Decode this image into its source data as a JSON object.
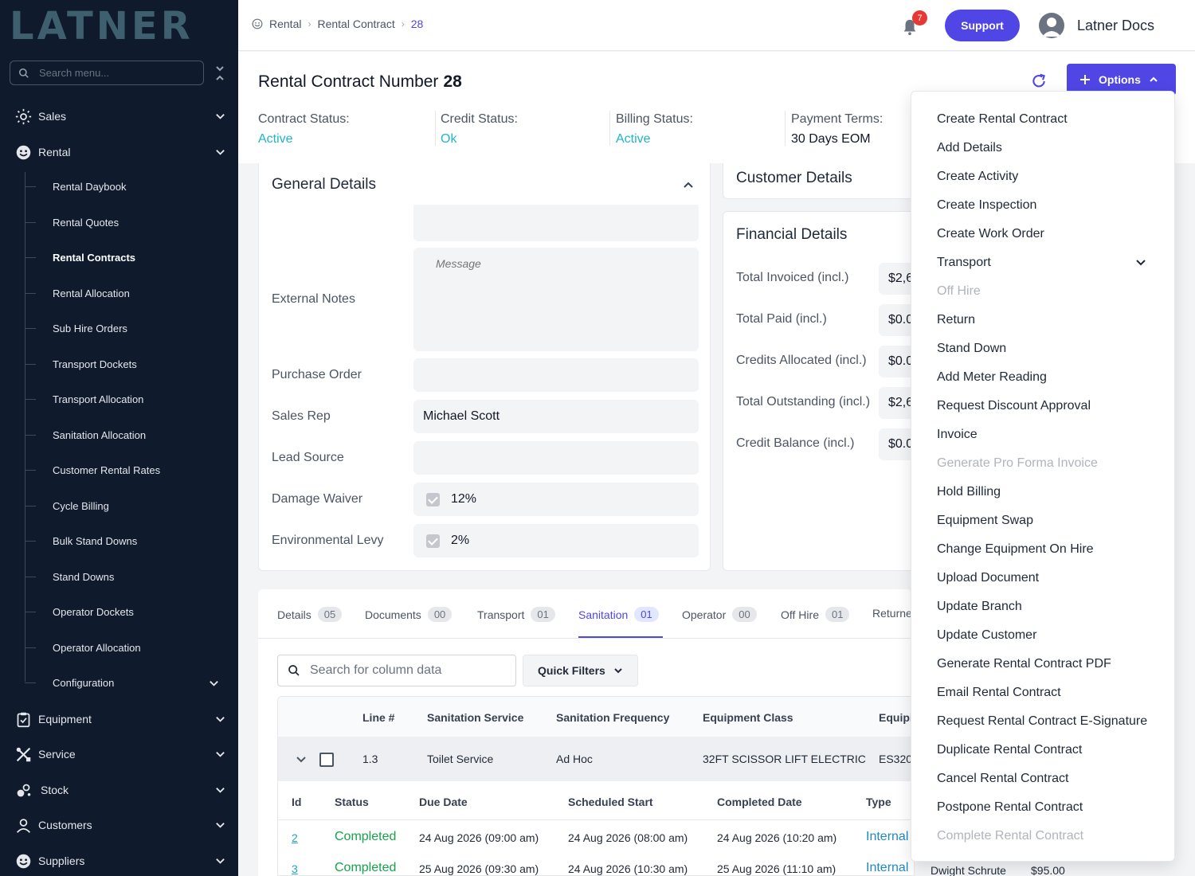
{
  "sidebar": {
    "logo": "LATNER",
    "search_placeholder": "Search menu...",
    "sections": [
      {
        "label": "Sales",
        "icon": "sun-gear-icon"
      },
      {
        "label": "Rental",
        "icon": "smile-face-icon"
      },
      {
        "label": "Equipment",
        "icon": "clipboard-icon"
      },
      {
        "label": "Service",
        "icon": "tools-icon"
      },
      {
        "label": "Stock",
        "icon": "stock-icon"
      },
      {
        "label": "Customers",
        "icon": "user-icon"
      },
      {
        "label": "Suppliers",
        "icon": "supplier-face-icon"
      }
    ],
    "rental_items": [
      "Rental Daybook",
      "Rental Quotes",
      "Rental Contracts",
      "Rental Allocation",
      "Sub Hire Orders",
      "Transport Dockets",
      "Transport Allocation",
      "Sanitation Allocation",
      "Customer Rental Rates",
      "Cycle Billing",
      "Bulk Stand Downs",
      "Stand Downs",
      "Operator Dockets",
      "Operator Allocation",
      "Configuration"
    ],
    "active_item": "Rental Contracts"
  },
  "topbar": {
    "breadcrumb": [
      "Rental",
      "Rental Contract",
      "28"
    ],
    "notification_count": "7",
    "support_label": "Support",
    "user_name": "Latner Docs"
  },
  "header": {
    "title_prefix": "Rental Contract Number",
    "contract_number": "28",
    "options_label": "Options",
    "stats": [
      {
        "label": "Contract Status:",
        "value": "Active"
      },
      {
        "label": "Credit Status:",
        "value": "Ok"
      },
      {
        "label": "Billing Status:",
        "value": "Active"
      },
      {
        "label": "Payment Terms:",
        "value": "30 Days EOM"
      }
    ]
  },
  "general": {
    "title": "General Details",
    "external_notes_label": "External Notes",
    "message_placeholder": "Message",
    "purchase_order_label": "Purchase Order",
    "sales_rep_label": "Sales Rep",
    "sales_rep_value": "Michael Scott",
    "lead_source_label": "Lead Source",
    "damage_waiver_label": "Damage Waiver",
    "damage_waiver_value": "12%",
    "env_levy_label": "Environmental Levy",
    "env_levy_value": "2%"
  },
  "customer": {
    "title": "Customer Details"
  },
  "financial": {
    "title": "Financial Details",
    "rows": [
      {
        "label": "Total Invoiced (incl.)",
        "value": "$2,6"
      },
      {
        "label": "Total Paid (incl.)",
        "value": "$0.0"
      },
      {
        "label": "Credits Allocated (incl.)",
        "value": "$0.0"
      },
      {
        "label": "Total Outstanding (incl.)",
        "value": "$2,6"
      },
      {
        "label": "Credit Balance (incl.)",
        "value": "$0.0"
      }
    ]
  },
  "tabs": [
    {
      "label": "Details",
      "count": "05"
    },
    {
      "label": "Documents",
      "count": "00"
    },
    {
      "label": "Transport",
      "count": "01"
    },
    {
      "label": "Sanitation",
      "count": "01"
    },
    {
      "label": "Operator",
      "count": "00"
    },
    {
      "label": "Off Hire",
      "count": "01"
    },
    {
      "label": "Returne",
      "count": ""
    }
  ],
  "table": {
    "search_placeholder": "Search for column data",
    "quick_filters": "Quick Filters",
    "headers": [
      "Line #",
      "Sanitation Service",
      "Sanitation Frequency",
      "Equipment Class",
      "Equipi"
    ],
    "row": {
      "line": "1.3",
      "service": "Toilet Service",
      "frequency": "Ad Hoc",
      "class": "32FT SCISSOR LIFT ELECTRIC",
      "equip": "ES320"
    },
    "sub_headers": [
      "Id",
      "Status",
      "Due Date",
      "Scheduled Start",
      "Completed Date",
      "Type"
    ],
    "sub_rows": [
      {
        "id": "2",
        "status": "Completed",
        "due": "24 Aug 2026 (09:00 am)",
        "start": "24 Aug 2026 (08:00 am)",
        "completed": "24 Aug 2026 (10:20 am)",
        "type": "Internal",
        "person": "",
        "price": ""
      },
      {
        "id": "3",
        "status": "Completed",
        "due": "25 Aug 2026 (09:30 am)",
        "start": "24 Aug 2026 (10:30 am)",
        "completed": "25 Aug 2026 (11:10 am)",
        "type": "Internal",
        "person": "Dwight Schrute",
        "price": "$95.00"
      }
    ]
  },
  "options_menu": [
    {
      "label": "Create Rental Contract",
      "disabled": false
    },
    {
      "label": "Add Details",
      "disabled": false
    },
    {
      "label": "Create Activity",
      "disabled": false
    },
    {
      "label": "Create Inspection",
      "disabled": false
    },
    {
      "label": "Create Work Order",
      "disabled": false
    },
    {
      "label": "Transport",
      "disabled": false,
      "submenu": true
    },
    {
      "label": "Off Hire",
      "disabled": true
    },
    {
      "label": "Return",
      "disabled": false
    },
    {
      "label": "Stand Down",
      "disabled": false
    },
    {
      "label": "Add Meter Reading",
      "disabled": false
    },
    {
      "label": "Request Discount Approval",
      "disabled": false
    },
    {
      "label": "Invoice",
      "disabled": false
    },
    {
      "label": "Generate Pro Forma Invoice",
      "disabled": true
    },
    {
      "label": "Hold Billing",
      "disabled": false
    },
    {
      "label": "Equipment Swap",
      "disabled": false
    },
    {
      "label": "Change Equipment On Hire",
      "disabled": false
    },
    {
      "label": "Upload Document",
      "disabled": false
    },
    {
      "label": "Update Branch",
      "disabled": false
    },
    {
      "label": "Update Customer",
      "disabled": false
    },
    {
      "label": "Generate Rental Contract PDF",
      "disabled": false
    },
    {
      "label": "Email Rental Contract",
      "disabled": false
    },
    {
      "label": "Request Rental Contract E-Signature",
      "disabled": false
    },
    {
      "label": "Duplicate Rental Contract",
      "disabled": false
    },
    {
      "label": "Cancel Rental Contract",
      "disabled": false
    },
    {
      "label": "Postpone Rental Contract",
      "disabled": false
    },
    {
      "label": "Complete Rental Contract",
      "disabled": true
    }
  ],
  "colors": {
    "accent": "#4f46e5",
    "sidebar_bg": "#0f1b2d",
    "teal": "#22b5c9",
    "completed": "#16a34a",
    "badge": "#e53935"
  }
}
